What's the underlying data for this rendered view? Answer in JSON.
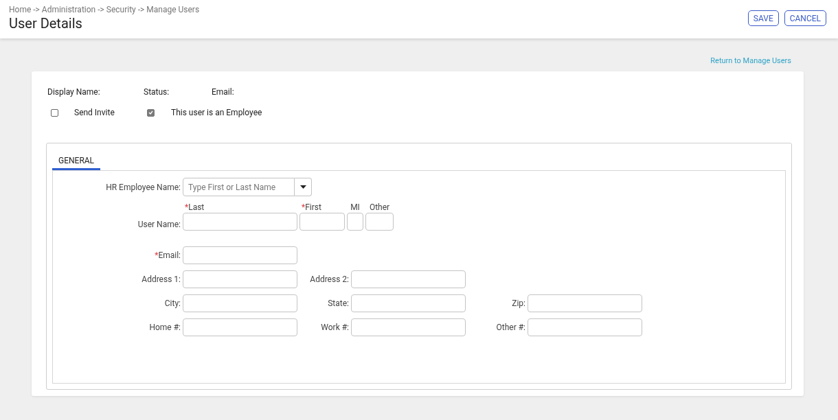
{
  "header": {
    "breadcrumb": "Home -> Administration -> Security -> Manage Users",
    "title": "User Details",
    "buttons": [
      "SAVE",
      "CANCEL"
    ]
  },
  "return_link": "Return to Manage Users",
  "summary": [
    {
      "label": "Display Name:"
    },
    {
      "label": "Status:"
    },
    {
      "label": "Email:"
    }
  ],
  "options": [
    {
      "label": "Send Invite",
      "checked": false,
      "disabled": false
    },
    {
      "label": "This user is an Employee",
      "checked": true,
      "disabled": true
    }
  ],
  "tabs": [
    {
      "label": "GENERAL",
      "selected": true
    }
  ],
  "hr_employee": {
    "label": "HR Employee Name:",
    "placeholder": "Type First or Last Name"
  },
  "user_name": {
    "label": "User Name:",
    "required_mark": "*",
    "parts": [
      {
        "heading": "Last",
        "required": true
      },
      {
        "heading": "First",
        "required": true
      },
      {
        "heading": "MI",
        "required": false
      },
      {
        "heading": "Other",
        "required": false
      }
    ]
  },
  "email": {
    "label": "Email:",
    "required": true
  },
  "rows": [
    [
      {
        "label": "Address 1:"
      },
      {
        "label": "Address 2:"
      }
    ],
    [
      {
        "label": "City:"
      },
      {
        "label": "State:"
      },
      {
        "label": "Zip:"
      }
    ],
    [
      {
        "label": "Home #:"
      },
      {
        "label": "Work #:"
      },
      {
        "label": "Other #:"
      }
    ]
  ]
}
